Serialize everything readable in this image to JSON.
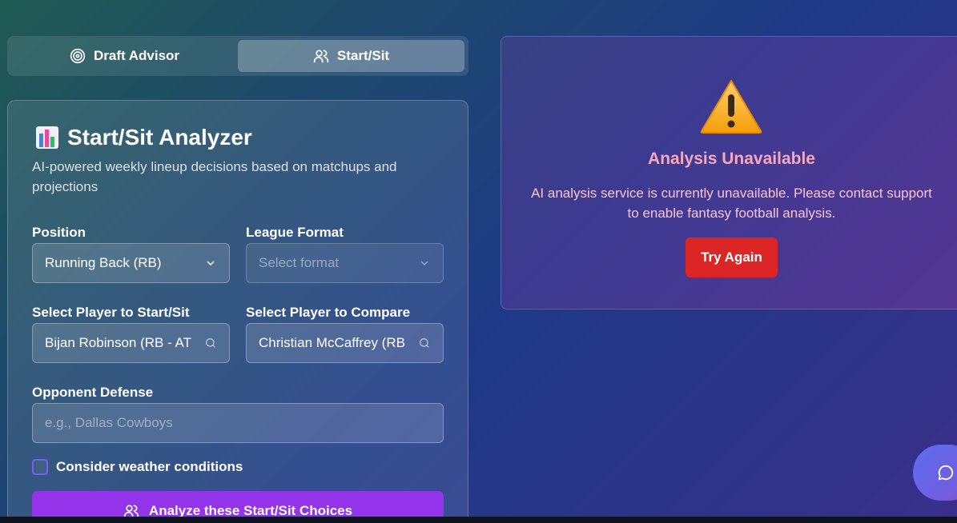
{
  "tabs": [
    {
      "label": "Draft Advisor",
      "icon": "target-icon",
      "active": false
    },
    {
      "label": "Start/Sit",
      "icon": "users-icon",
      "active": true
    }
  ],
  "analyzer": {
    "title": "Start/Sit Analyzer",
    "title_icon": "bar-chart-emoji-icon",
    "subtitle": "AI-powered weekly lineup decisions based on matchups and projections",
    "position_label": "Position",
    "position_value": "Running Back (RB)",
    "league_label": "League Format",
    "league_placeholder": "Select format",
    "player_label": "Select Player to Start/Sit",
    "player_value": "Bijan Robinson (RB - AT",
    "compare_label": "Select Player to Compare",
    "compare_value": "Christian McCaffrey (RB",
    "opponent_label": "Opponent Defense",
    "opponent_placeholder": "e.g., Dallas Cowboys",
    "weather_label": "Consider weather conditions",
    "weather_checked": false,
    "analyze_label": "Analyze these Start/Sit Choices"
  },
  "error_panel": {
    "icon": "warning-icon",
    "title": "Analysis Unavailable",
    "message": "AI analysis service is currently unavailable. Please contact support to enable fantasy football analysis.",
    "retry_label": "Try Again"
  },
  "chat": {
    "icon": "chat-bubble-icon"
  },
  "colors": {
    "accent_purple": "#9333ea",
    "danger_red": "#dc2626",
    "error_title": "#f7a7c0"
  }
}
